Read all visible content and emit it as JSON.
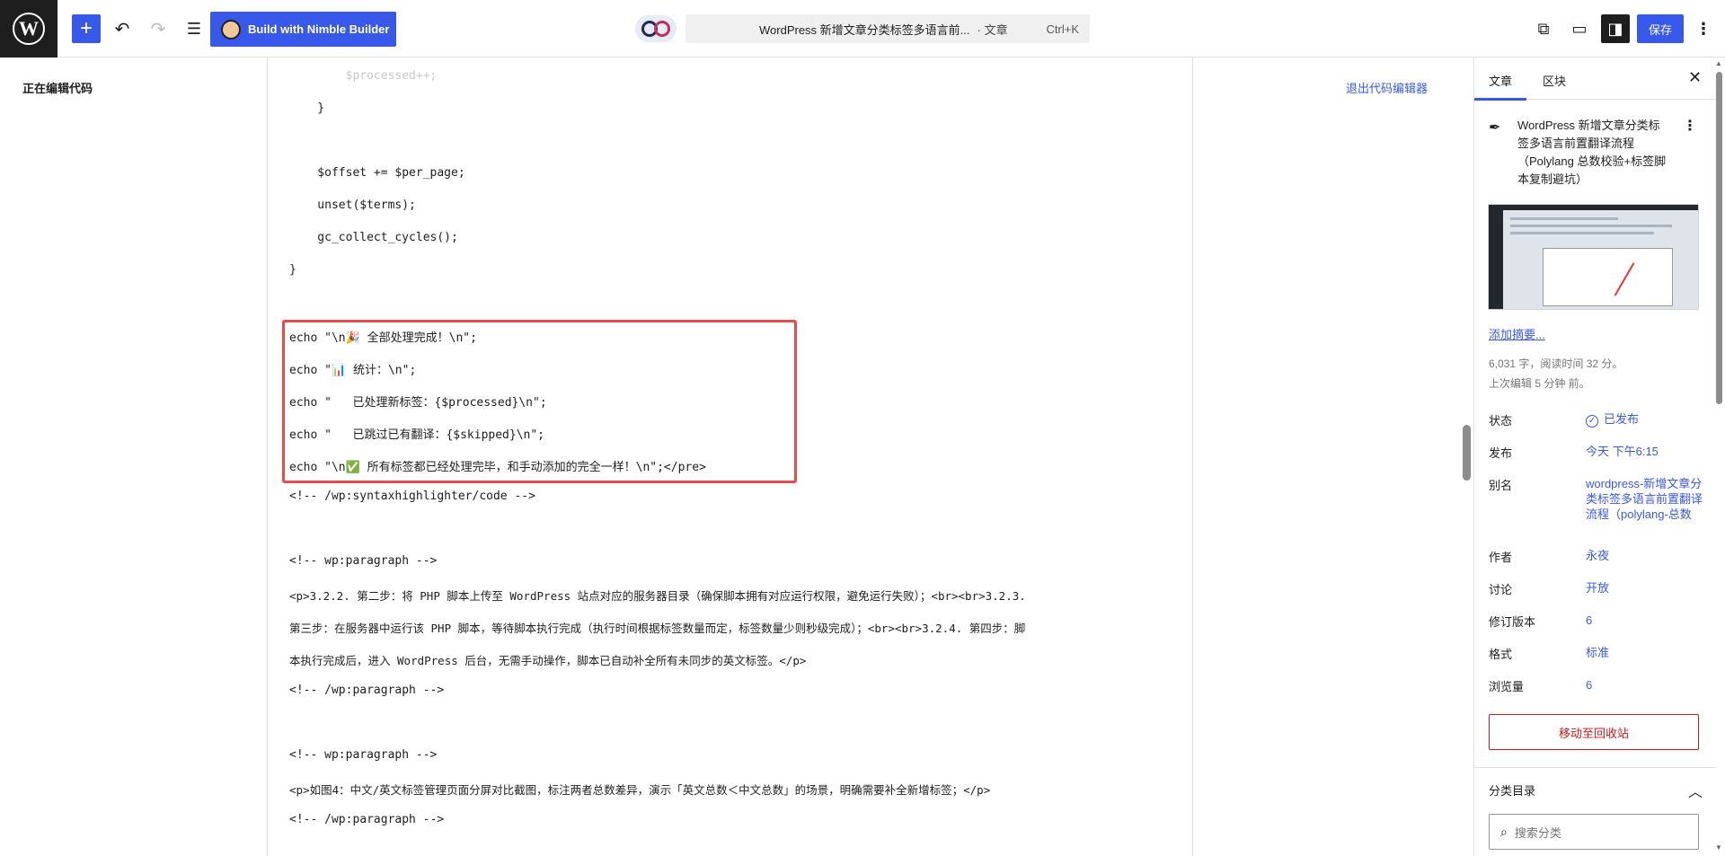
{
  "toolbar": {
    "nimble_label": "Build with Nimble Builder",
    "doc_title": "WordPress 新增文章分类标签多语言前...",
    "doc_type": "· 文章",
    "shortcut": "Ctrl+K",
    "save_label": "保存"
  },
  "left_panel": {
    "label": "正在编辑代码"
  },
  "editor": {
    "exit_label": "退出代码编辑器",
    "lines": [
      "        $processed++;",
      "    }",
      "    $offset += $per_page;",
      "    unset($terms);",
      "    gc_collect_cycles();",
      "}",
      "echo \"\\n🎉 全部处理完成！\\n\";",
      "echo \"📊 统计：\\n\";",
      "echo \"   已处理新标签：{$processed}\\n\";",
      "echo \"   已跳过已有翻译：{$skipped}\\n\";",
      "echo \"\\n✅ 所有标签都已经处理完毕，和手动添加的完全一样！\\n\";</pre>",
      "<!-- /wp:syntaxhighlighter/code -->",
      "<!-- wp:paragraph -->",
      "<p>3.2.2. 第二步：将 PHP 脚本上传至 WordPress 站点对应的服务器目录（确保脚本拥有对应运行权限，避免运行失败）；<br><br>3.2.3.",
      "第三步：在服务器中运行该 PHP 脚本，等待脚本执行完成（执行时间根据标签数量而定，标签数量少则秒级完成）；<br><br>3.2.4. 第四步：脚",
      "本执行完成后，进入 WordPress 后台，无需手动操作，脚本已自动补全所有未同步的英文标签。</p>",
      "<!-- /wp:paragraph -->",
      "<!-- wp:paragraph -->",
      "<p>如图4：中文/英文标签管理页面分屏对比截图，标注两者总数差异，演示「英文总数＜中文总数」的场景，明确需要补全新增标签；</p>",
      "<!-- /wp:paragraph -->"
    ]
  },
  "sidebar": {
    "tab_post": "文章",
    "tab_block": "区块",
    "post_title": "WordPress 新增文章分类标签多语言前置翻译流程（Polylang 总数校验+标签脚本复制避坑）",
    "add_excerpt": "添加摘要...",
    "word_count": "6,031 字，阅读时间 32 分。",
    "last_edit": "上次编辑 5 分钟 前。",
    "rows": [
      {
        "k": "状态",
        "v": "已发布"
      },
      {
        "k": "发布",
        "v": "今天 下午6:15"
      },
      {
        "k": "别名",
        "v": "wordpress-新增文章分类标签多语言前置翻译流程（polylang-总数"
      },
      {
        "k": "作者",
        "v": "永夜"
      },
      {
        "k": "讨论",
        "v": "开放"
      },
      {
        "k": "修订版本",
        "v": "6"
      },
      {
        "k": "格式",
        "v": "标准"
      },
      {
        "k": "浏览量",
        "v": "6"
      }
    ],
    "trash_label": "移动至回收站",
    "category_title": "分类目录",
    "category_search_placeholder": "搜索分类"
  }
}
